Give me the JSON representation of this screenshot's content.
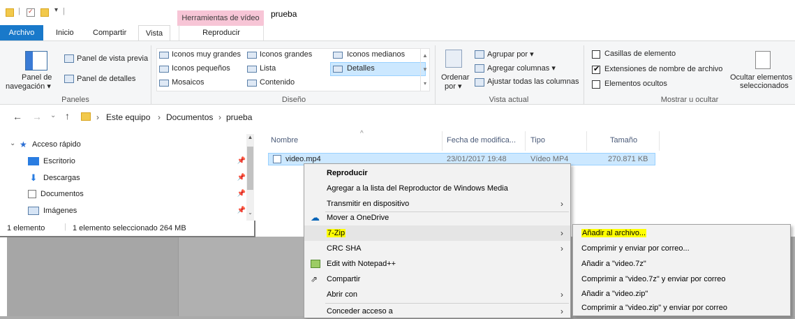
{
  "window": {
    "title": "prueba",
    "contextual_tab_label": "Herramientas de vídeo"
  },
  "tabs": {
    "file": "Archivo",
    "items": [
      "Inicio",
      "Compartir",
      "Vista",
      "Reproducir"
    ],
    "active": "Vista"
  },
  "ribbon": {
    "paneles": {
      "label": "Paneles",
      "nav_pane_l1": "Panel de",
      "nav_pane_l2": "navegación ▾",
      "preview": "Panel de vista previa",
      "details": "Panel de detalles"
    },
    "diseno": {
      "label": "Diseño",
      "layouts": [
        "Iconos muy grandes",
        "Iconos grandes",
        "Iconos medianos",
        "Iconos pequeños",
        "Lista",
        "Detalles",
        "Mosaicos",
        "Contenido"
      ],
      "selected": "Detalles"
    },
    "vista_actual": {
      "label": "Vista actual",
      "sort_l1": "Ordenar",
      "sort_l2": "por ▾",
      "group": "Agrupar por ▾",
      "add_columns": "Agregar columnas ▾",
      "fit_columns": "Ajustar todas las columnas"
    },
    "mostrar": {
      "label": "Mostrar u ocultar",
      "item_checkboxes": "Casillas de elemento",
      "extensions": "Extensiones de nombre de archivo",
      "hidden_items": "Elementos ocultos",
      "hide_sel_l1": "Ocultar elementos",
      "hide_sel_l2": "seleccionados",
      "checks": {
        "item_checkboxes": false,
        "extensions": true,
        "hidden_items": false
      }
    }
  },
  "address": {
    "crumbs": [
      "Este equipo",
      "Documentos",
      "prueba"
    ]
  },
  "nav": {
    "quick_access": "Acceso rápido",
    "items": [
      "Escritorio",
      "Descargas",
      "Documentos",
      "Imágenes"
    ]
  },
  "columns": [
    "Nombre",
    "Fecha de modifica...",
    "Tipo",
    "Tamaño"
  ],
  "file": {
    "name": "video.mp4",
    "date": "23/01/2017 19:48",
    "type": "Vídeo MP4",
    "size": "270.871 KB"
  },
  "status": {
    "count": "1 elemento",
    "selected": "1 elemento seleccionado  264 MB"
  },
  "context_menu": [
    "Reproducir",
    "Agregar a la lista del Reproductor de Windows Media",
    "Transmitir en dispositivo",
    "Mover a OneDrive",
    "7-Zip",
    "CRC SHA",
    "Edit with Notepad++",
    "Compartir",
    "Abrir con",
    "Conceder acceso a"
  ],
  "submenu_7zip": [
    "Añadir al archivo...",
    "Comprimir y enviar por correo...",
    "Añadir a \"video.7z\"",
    "Comprimir a \"video.7z\" y enviar por correo",
    "Añadir a \"video.zip\"",
    "Comprimir a \"video.zip\" y enviar por correo"
  ],
  "colors": {
    "file_tab": "#1979ca",
    "selection": "#cce8ff",
    "highlight_text": "#ffff00",
    "contextual_tab": "#f7c5d6"
  }
}
